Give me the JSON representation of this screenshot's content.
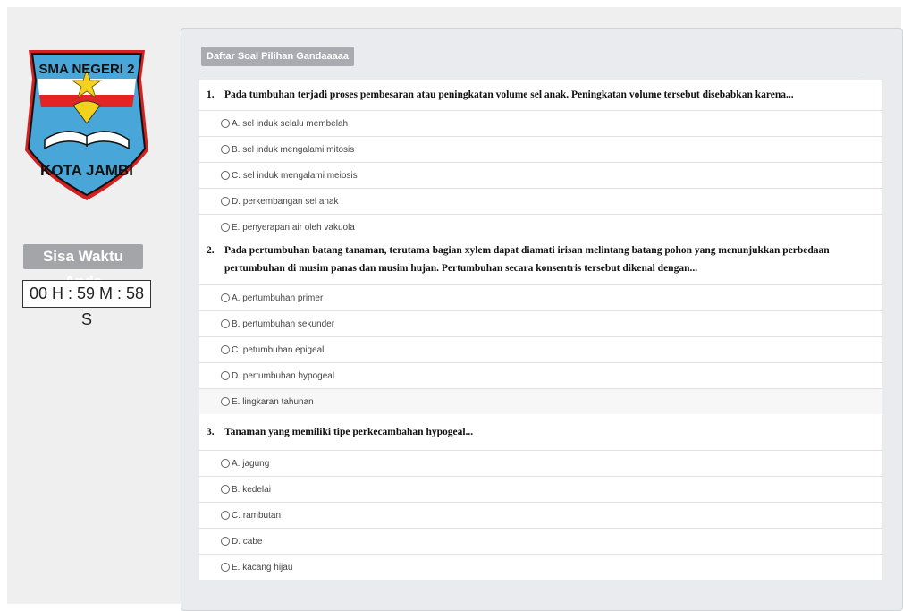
{
  "logo": {
    "school_name": "SMA NEGERI 2",
    "city": "KOTA JAMBI"
  },
  "timer": {
    "label": "Sisa Waktu Anda",
    "value": "00 H : 59 M : 58 S"
  },
  "panel": {
    "tab_label": "Daftar Soal Pilihan Gandaaaaa"
  },
  "questions": [
    {
      "number": "1.",
      "text": "Pada tumbuhan terjadi proses pembesaran atau peningkatan volume sel anak. Peningkatan volume tersebut disebabkan karena...",
      "options": [
        "A. sel induk selalu membelah",
        "B. sel induk mengalami mitosis",
        "C. sel induk mengalami meiosis",
        "D. perkembangan sel anak",
        "E. penyerapan air oleh vakuola"
      ]
    },
    {
      "number": "2.",
      "text": "Pada pertumbuhan batang tanaman, terutama bagian xylem dapat diamati  irisan melintang batang pohon   yang  menunjukkan perbedaan pertumbuhan di musim panas dan musim hujan. Pertumbuhan secara konsentris tersebut dikenal dengan...",
      "options": [
        "A. pertumbuhan primer",
        "B. pertumbuhan sekunder",
        "C. petumbuhan epigeal",
        "D. pertumbuhan hypogeal",
        "E. lingkaran tahunan"
      ]
    },
    {
      "number": "3.",
      "text": "Tanaman yang memiliki tipe perkecambahan hypogeal...",
      "options": [
        "A. jagung",
        "B. kedelai",
        "C. rambutan",
        "D. cabe",
        "E. kacang hijau"
      ]
    }
  ]
}
